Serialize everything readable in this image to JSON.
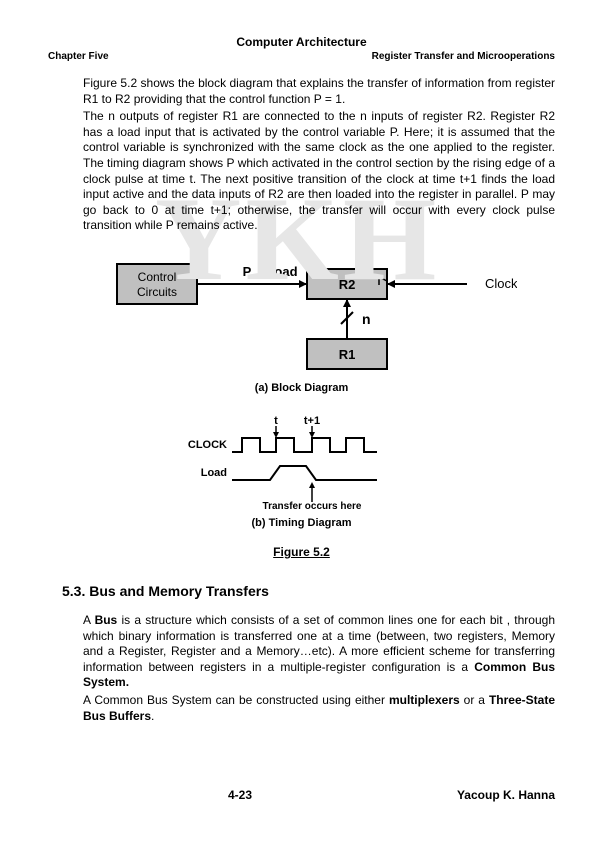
{
  "header": {
    "title": "Computer Architecture",
    "left": "Chapter Five",
    "right": "Register Transfer and Microoperations"
  },
  "watermark": "YKH",
  "para1": "Figure 5.2 shows the block diagram that explains the transfer of information from register R1 to R2 providing that the control function  P = 1.",
  "para2": "The n outputs of register R1 are connected to the n inputs of register R2. Register R2 has a load input that is activated by the control variable P. Here; it is assumed that the control variable is synchronized with the same clock as the one applied to the register. The timing diagram shows P which activated in the control section by the rising edge of a clock pulse at time t. The next positive transition of the clock at time t+1 finds the load input active and the data inputs of R2 are then loaded into the register in parallel. P may go back to 0 at time t+1; otherwise, the transfer will occur with every clock pulse transition while P remains active.",
  "diagram_block": {
    "control_circuits": "Control\nCircuits",
    "p": "P",
    "load": "Load",
    "r2": "R2",
    "r1": "R1",
    "clock": "Clock",
    "n": "n"
  },
  "caption_a": "(a) Block Diagram",
  "diagram_timing": {
    "t": "t",
    "t1": "t+1",
    "clock": "CLOCK",
    "load": "Load",
    "transfer": "Transfer occurs here"
  },
  "caption_b": "(b) Timing Diagram",
  "figure_label": "Figure 5.2",
  "section_heading": "5.3. Bus and Memory Transfers",
  "para3_pre": "A ",
  "para3_bold1": "Bus",
  "para3_mid1": " is a structure which consists of a set of common lines one for each bit , through which binary information is transferred one at a time (between, two registers, Memory and a Register, Register and a Memory…etc). A more efficient scheme for transferring information between registers in a multiple-register configuration is a ",
  "para3_bold2": "Common Bus System.",
  "para4_pre": "A Common Bus System can be constructed using either ",
  "para4_bold1": "multiplexers",
  "para4_mid": " or a ",
  "para4_bold2": "Three-State Bus Buffers",
  "para4_end": ".",
  "footer": {
    "page": "4-23",
    "author": "Yacoup K. Hanna"
  }
}
